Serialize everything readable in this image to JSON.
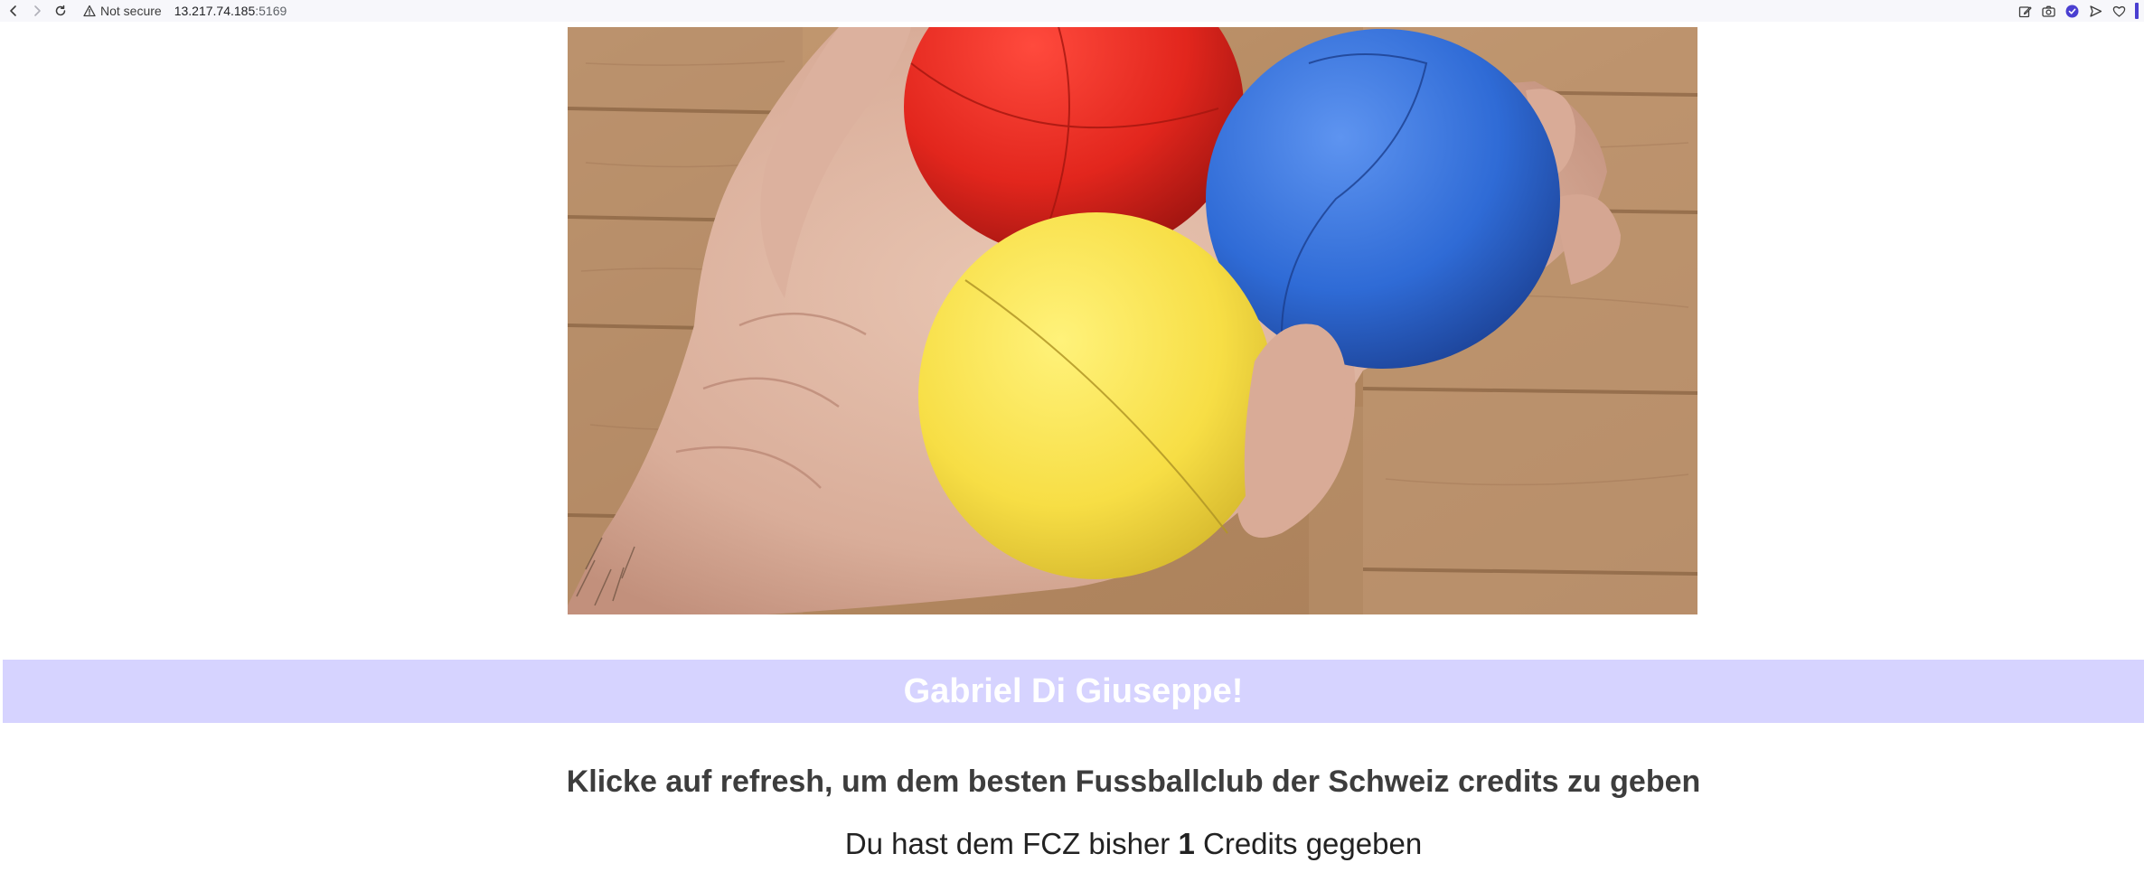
{
  "browser": {
    "security_label": "Not secure",
    "url_host": "13.217.74.185",
    "url_port": ":5169",
    "accent_color": "#4a3fd1",
    "icons": [
      "back-icon",
      "forward-icon",
      "reload-icon",
      "warning-icon",
      "edit-icon",
      "camera-icon",
      "shield-check-icon",
      "send-icon",
      "heart-icon"
    ]
  },
  "hero": {
    "image_subject": "juggling-balls-in-hand"
  },
  "banner": {
    "title": "Gabriel Di Giuseppe!",
    "background_color": "#d6d3ff"
  },
  "content": {
    "instruction": "Klicke auf refresh, um dem besten Fussballclub der Schweiz credits zu geben",
    "credits_prefix": "Du hast dem FCZ bisher",
    "credits_count": "1",
    "credits_suffix": "Credits gegeben"
  }
}
